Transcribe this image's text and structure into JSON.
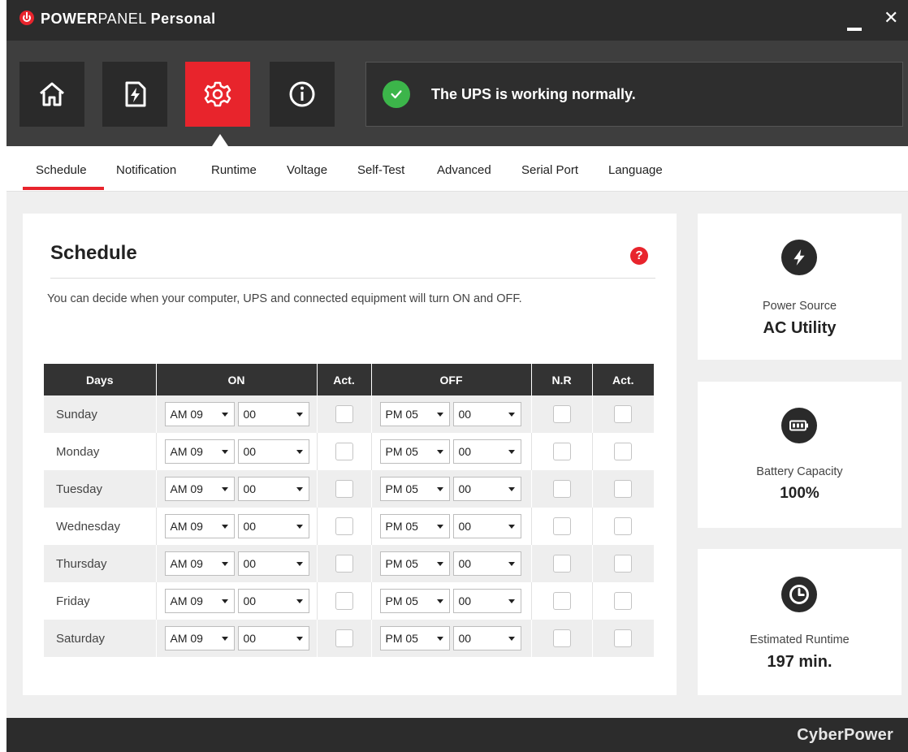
{
  "app": {
    "title_bold": "POWER",
    "title_regular": "PANEL",
    "title_suffix": "Personal"
  },
  "window": {
    "minimize_icon": "minimize-icon",
    "close_label": "✕"
  },
  "toolbar": {
    "buttons": [
      {
        "icon": "home-icon"
      },
      {
        "icon": "power-file-icon"
      },
      {
        "icon": "settings-gear-icon",
        "active": true
      },
      {
        "icon": "info-icon"
      }
    ],
    "status_text": "The UPS is working normally."
  },
  "tabs": [
    "Schedule",
    "Notification",
    "Runtime",
    "Voltage",
    "Self-Test",
    "Advanced",
    "Serial Port",
    "Language"
  ],
  "schedule": {
    "title": "Schedule",
    "help": "?",
    "description": "You can decide when your computer, UPS and connected equipment will turn ON and OFF.",
    "headers": {
      "days": "Days",
      "on": "ON",
      "act": "Act.",
      "off": "OFF",
      "nr": "N.R",
      "act2": "Act."
    },
    "rows": [
      {
        "day": "Sunday",
        "on_hour": "AM 09",
        "on_min": "00",
        "off_hour": "PM 05",
        "off_min": "00"
      },
      {
        "day": "Monday",
        "on_hour": "AM 09",
        "on_min": "00",
        "off_hour": "PM 05",
        "off_min": "00"
      },
      {
        "day": "Tuesday",
        "on_hour": "AM 09",
        "on_min": "00",
        "off_hour": "PM 05",
        "off_min": "00"
      },
      {
        "day": "Wednesday",
        "on_hour": "AM 09",
        "on_min": "00",
        "off_hour": "PM 05",
        "off_min": "00"
      },
      {
        "day": "Thursday",
        "on_hour": "AM 09",
        "on_min": "00",
        "off_hour": "PM 05",
        "off_min": "00"
      },
      {
        "day": "Friday",
        "on_hour": "AM 09",
        "on_min": "00",
        "off_hour": "PM 05",
        "off_min": "00"
      },
      {
        "day": "Saturday",
        "on_hour": "AM 09",
        "on_min": "00",
        "off_hour": "PM 05",
        "off_min": "00"
      }
    ]
  },
  "status_cards": {
    "power_source": {
      "label": "Power Source",
      "value": "AC Utility",
      "icon": "lightning-icon"
    },
    "battery": {
      "label": "Battery Capacity",
      "value": "100%",
      "icon": "battery-icon"
    },
    "runtime": {
      "label": "Estimated Runtime",
      "value": "197 min.",
      "icon": "clock-icon"
    }
  },
  "footer": {
    "brand": "CyberPower"
  },
  "colors": {
    "accent": "#e8242c",
    "success": "#3cb54a",
    "titlebar": "#2c2c2c",
    "toolbar": "#3e3e3e"
  }
}
